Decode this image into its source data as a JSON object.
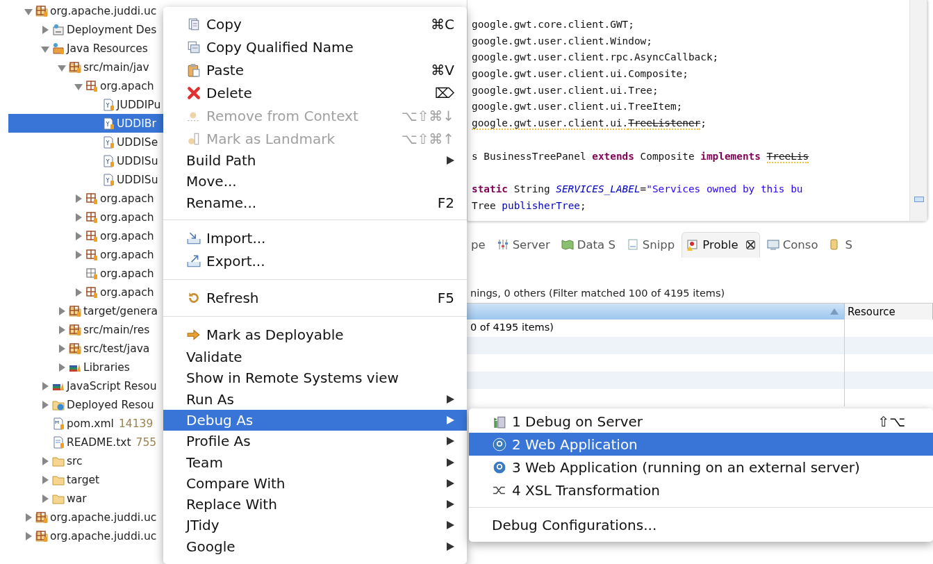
{
  "tree": [
    {
      "label": "org.apache.juddi.uc",
      "kind": "project",
      "expandable": true,
      "expanded": true,
      "selected": false,
      "children": [
        {
          "label": "Deployment Des",
          "kind": "descriptor",
          "expandable": true,
          "expanded": false,
          "selected": false
        },
        {
          "label": "Java Resources",
          "kind": "resources",
          "expandable": true,
          "expanded": true,
          "selected": false,
          "children": [
            {
              "label": "src/main/jav",
              "kind": "source-folder",
              "expandable": true,
              "expanded": true,
              "selected": false,
              "children": [
                {
                  "label": "org.apach",
                  "kind": "package-open",
                  "expandable": true,
                  "expanded": true,
                  "selected": false,
                  "children": [
                    {
                      "label": "JUDDIPu",
                      "kind": "java-file",
                      "expandable": false,
                      "selected": false
                    },
                    {
                      "label": "UDDIBr",
                      "kind": "java-file",
                      "expandable": false,
                      "selected": true
                    },
                    {
                      "label": "UDDISe",
                      "kind": "java-file",
                      "expandable": false,
                      "selected": false
                    },
                    {
                      "label": "UDDISu",
                      "kind": "java-file",
                      "expandable": false,
                      "selected": false
                    },
                    {
                      "label": "UDDISu",
                      "kind": "java-file",
                      "expandable": false,
                      "selected": false
                    }
                  ]
                },
                {
                  "label": "org.apach",
                  "kind": "package",
                  "expandable": true,
                  "expanded": false,
                  "selected": false
                },
                {
                  "label": "org.apach",
                  "kind": "package",
                  "expandable": true,
                  "expanded": false,
                  "selected": false
                },
                {
                  "label": "org.apach",
                  "kind": "package",
                  "expandable": true,
                  "expanded": false,
                  "selected": false
                },
                {
                  "label": "org.apach",
                  "kind": "package",
                  "expandable": true,
                  "expanded": false,
                  "selected": false
                },
                {
                  "label": "org.apach",
                  "kind": "package-empty",
                  "expandable": false,
                  "selected": false
                },
                {
                  "label": "org.apach",
                  "kind": "package",
                  "expandable": true,
                  "expanded": false,
                  "selected": false
                }
              ]
            },
            {
              "label": "target/genera",
              "kind": "source-folder",
              "expandable": true,
              "expanded": false,
              "selected": false
            },
            {
              "label": "src/main/res",
              "kind": "source-folder",
              "expandable": true,
              "expanded": false,
              "selected": false
            },
            {
              "label": "src/test/java",
              "kind": "source-folder",
              "expandable": true,
              "expanded": false,
              "selected": false
            },
            {
              "label": "Libraries",
              "kind": "library",
              "expandable": true,
              "expanded": false,
              "selected": false
            }
          ]
        },
        {
          "label": "JavaScript Resou",
          "kind": "library",
          "expandable": true,
          "expanded": false,
          "selected": false
        },
        {
          "label": "Deployed Resou",
          "kind": "deployed",
          "expandable": true,
          "expanded": false,
          "selected": false
        },
        {
          "label": "pom.xml",
          "note": "14139",
          "kind": "xml-file",
          "expandable": false,
          "selected": false
        },
        {
          "label": "README.txt",
          "note": "755",
          "kind": "text-file",
          "expandable": false,
          "selected": false
        },
        {
          "label": "src",
          "kind": "folder",
          "expandable": true,
          "expanded": false,
          "selected": false
        },
        {
          "label": "target",
          "kind": "folder",
          "expandable": true,
          "expanded": false,
          "selected": false
        },
        {
          "label": "war",
          "kind": "folder",
          "expandable": true,
          "expanded": false,
          "selected": false
        }
      ]
    },
    {
      "label": "org.apache.juddi.uc",
      "kind": "project",
      "expandable": true,
      "expanded": false,
      "selected": false
    },
    {
      "label": "org.apache.juddi.uc",
      "kind": "project",
      "expandable": true,
      "expanded": false,
      "selected": false
    }
  ],
  "editor": {
    "lines": [
      {
        "space_before": false,
        "tokens": [
          {
            "kind": "plain",
            "text": "google.gwt.core.client.GWT;"
          }
        ]
      },
      {
        "space_before": false,
        "tokens": [
          {
            "kind": "plain",
            "text": "google.gwt.user.client.Window;"
          }
        ]
      },
      {
        "space_before": false,
        "tokens": [
          {
            "kind": "plain",
            "text": "google.gwt.user.client.rpc.AsyncCallback;"
          }
        ]
      },
      {
        "space_before": false,
        "tokens": [
          {
            "kind": "plain",
            "text": "google.gwt.user.client.ui.Composite;"
          }
        ]
      },
      {
        "space_before": false,
        "tokens": [
          {
            "kind": "plain",
            "text": "google.gwt.user.client.ui.Tree;"
          }
        ]
      },
      {
        "space_before": false,
        "tokens": [
          {
            "kind": "plain",
            "text": "google.gwt.user.client.ui.TreeItem;"
          }
        ]
      },
      {
        "space_before": false,
        "tokens": [
          {
            "kind": "warn",
            "text": "google.gwt.user.client.ui."
          },
          {
            "kind": "deprecated",
            "text": "TreeListener"
          },
          {
            "kind": "plain",
            "text": ";"
          }
        ]
      },
      {
        "space_before": true,
        "tokens": [
          {
            "kind": "plain",
            "text": "s BusinessTreePanel "
          },
          {
            "kind": "keyword",
            "text": "extends"
          },
          {
            "kind": "plain",
            "text": " Composite "
          },
          {
            "kind": "keyword",
            "text": "implements "
          },
          {
            "kind": "deprecated",
            "text": "TreeLis"
          }
        ]
      },
      {
        "space_before": true,
        "tokens": [
          {
            "kind": "keyword",
            "text": "static"
          },
          {
            "kind": "plain",
            "text": " String "
          },
          {
            "kind": "constant",
            "text": "SERVICES_LABEL"
          },
          {
            "kind": "plain",
            "text": "="
          },
          {
            "kind": "string",
            "text": "\"Services owned by this bu"
          }
        ]
      },
      {
        "space_before": false,
        "tokens": [
          {
            "kind": "plain",
            "text": "Tree "
          },
          {
            "kind": "field",
            "text": "publisherTree"
          },
          {
            "kind": "plain",
            "text": ";"
          }
        ]
      }
    ]
  },
  "panel": {
    "tabs": [
      {
        "label": "pe",
        "kind": "properties",
        "selected": false
      },
      {
        "label": "Server",
        "kind": "servers",
        "selected": false
      },
      {
        "label": "Data S",
        "kind": "data",
        "selected": false
      },
      {
        "label": "Snipp",
        "kind": "snippets",
        "selected": false
      },
      {
        "label": "Proble",
        "kind": "problems",
        "selected": true
      },
      {
        "label": "Conso",
        "kind": "console",
        "selected": false
      },
      {
        "label": "S",
        "kind": "svn",
        "selected": false
      }
    ],
    "summary": "nings, 0 others (Filter matched 100 of 4195 items)",
    "columns": [
      {
        "sorted": true
      },
      {
        "label": "Resource",
        "sorted": false
      }
    ],
    "rows": [
      "0 of 4195 items)",
      "",
      "",
      "",
      ""
    ]
  },
  "menu": [
    {
      "kind": "copy",
      "label": "Copy",
      "shortcut": "⌘C",
      "disabled": false,
      "submenu": false,
      "selected": false
    },
    {
      "kind": "copy-name",
      "label": "Copy Qualified Name",
      "disabled": false,
      "submenu": false,
      "selected": false
    },
    {
      "kind": "paste",
      "label": "Paste",
      "shortcut": "⌘V",
      "disabled": false,
      "submenu": false,
      "selected": false
    },
    {
      "kind": "delete",
      "label": "Delete",
      "shortcut": "⌦",
      "disabled": false,
      "submenu": false,
      "selected": false
    },
    {
      "kind": "context",
      "label": "Remove from Context",
      "shortcut": "⌥⇧⌘↓",
      "disabled": true,
      "submenu": false,
      "selected": false
    },
    {
      "kind": "landmark",
      "label": "Mark as Landmark",
      "shortcut": "⌥⇧⌘↑",
      "disabled": true,
      "submenu": false,
      "selected": false
    },
    {
      "kind": "plain",
      "label": "Build Path",
      "disabled": false,
      "submenu": true,
      "selected": false
    },
    {
      "kind": "plain",
      "label": "Move...",
      "disabled": false,
      "submenu": false,
      "selected": false
    },
    {
      "kind": "plain",
      "label": "Rename...",
      "shortcut": "F2",
      "disabled": false,
      "submenu": false,
      "selected": false
    },
    {
      "kind": "separator"
    },
    {
      "kind": "import",
      "label": "Import...",
      "disabled": false,
      "submenu": false,
      "selected": false
    },
    {
      "kind": "export",
      "label": "Export...",
      "disabled": false,
      "submenu": false,
      "selected": false
    },
    {
      "kind": "separator"
    },
    {
      "kind": "refresh",
      "label": "Refresh",
      "shortcut": "F5",
      "disabled": false,
      "submenu": false,
      "selected": false
    },
    {
      "kind": "separator"
    },
    {
      "kind": "deploy",
      "label": "Mark as Deployable",
      "disabled": false,
      "submenu": false,
      "selected": false
    },
    {
      "kind": "plain",
      "label": "Validate",
      "disabled": false,
      "submenu": false,
      "selected": false
    },
    {
      "kind": "plain",
      "label": "Show in Remote Systems view",
      "disabled": false,
      "submenu": false,
      "selected": false
    },
    {
      "kind": "plain",
      "label": "Run As",
      "disabled": false,
      "submenu": true,
      "selected": false
    },
    {
      "kind": "plain",
      "label": "Debug As",
      "disabled": false,
      "submenu": true,
      "selected": true
    },
    {
      "kind": "plain",
      "label": "Profile As",
      "disabled": false,
      "submenu": true,
      "selected": false
    },
    {
      "kind": "plain",
      "label": "Team",
      "disabled": false,
      "submenu": true,
      "selected": false
    },
    {
      "kind": "plain",
      "label": "Compare With",
      "disabled": false,
      "submenu": true,
      "selected": false
    },
    {
      "kind": "plain",
      "label": "Replace With",
      "disabled": false,
      "submenu": true,
      "selected": false
    },
    {
      "kind": "plain",
      "label": "JTidy",
      "disabled": false,
      "submenu": true,
      "selected": false
    },
    {
      "kind": "plain",
      "label": "Google",
      "disabled": false,
      "submenu": true,
      "selected": false
    }
  ],
  "submenu": [
    {
      "kind": "server",
      "label": "1 Debug on Server",
      "shortcut": "⇧⌥",
      "selected": false
    },
    {
      "kind": "google",
      "label": "2 Web Application",
      "selected": true
    },
    {
      "kind": "google",
      "label": "3 Web Application (running on an external server)",
      "selected": false
    },
    {
      "kind": "xsl",
      "label": "4 XSL Transformation",
      "selected": false
    },
    {
      "kind": "separator"
    },
    {
      "kind": "plain",
      "label": "Debug Configurations...",
      "selected": false
    }
  ]
}
